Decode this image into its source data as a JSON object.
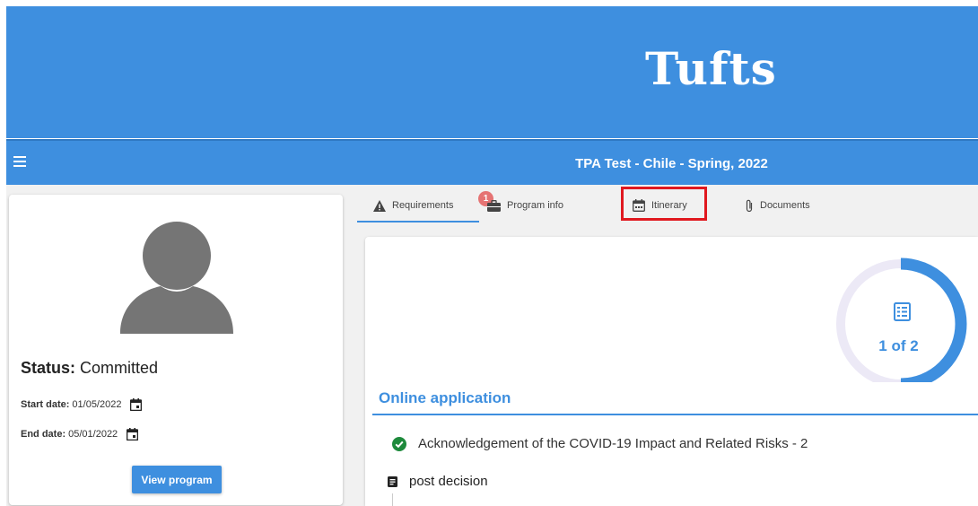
{
  "header": {
    "logo_text": "Tufts"
  },
  "navbar": {
    "menu_icon": "hamburger-menu-icon",
    "title": "TPA Test - Chile - Spring, 2022"
  },
  "profile": {
    "avatar_icon": "user-avatar-icon",
    "status_label": "Status:",
    "status_value": "Committed",
    "start_label": "Start date:",
    "start_value": "01/05/2022",
    "end_label": "End date:",
    "end_value": "05/01/2022",
    "calendar_icon": "calendar-icon",
    "view_button": "View program"
  },
  "tabs": [
    {
      "label": "Requirements",
      "icon": "warning-icon",
      "badge": "1",
      "active": true
    },
    {
      "label": "Program info",
      "icon": "briefcase-icon"
    },
    {
      "label": "Itinerary",
      "icon": "calendar-icon",
      "highlighted": true
    },
    {
      "label": "Documents",
      "icon": "paperclip-icon"
    }
  ],
  "progress": {
    "text": "1 of 2",
    "completed": 1,
    "total": 2,
    "icon": "checklist-icon"
  },
  "section": {
    "title": "Online application",
    "items": [
      {
        "label": "Acknowledgement of the COVID-19 Impact and Related Risks - 2",
        "icon": "check-circle-icon",
        "status_color": "#1e8a3c"
      }
    ],
    "group": {
      "label": "post decision",
      "icon": "document-icon"
    }
  },
  "colors": {
    "brand": "#3e8fdf",
    "highlight": "#e0181f",
    "badge": "#e57373"
  }
}
